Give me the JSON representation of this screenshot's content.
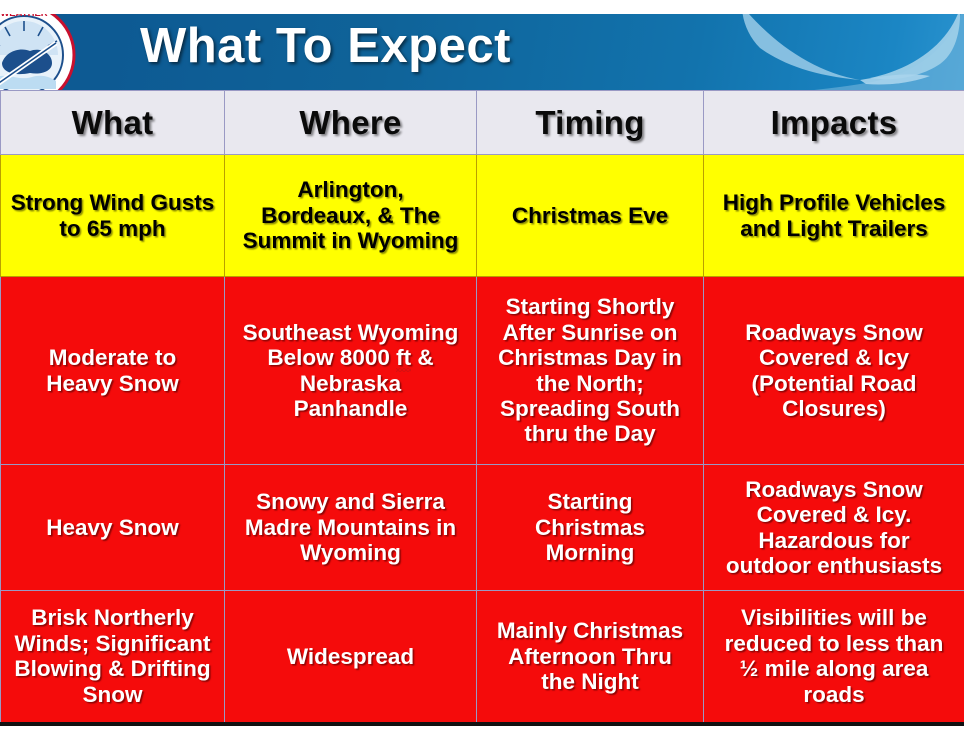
{
  "banner": {
    "title": "What To Expect",
    "logo_alt": "nws-logo",
    "gradient_start": "#0d5a93",
    "gradient_end": "#2a93cf",
    "swoosh_color": "#8cc3e3"
  },
  "colors": {
    "header_bg": "#e9e8ef",
    "yellow_bg": "#ffff00",
    "red_bg": "#f50b0b",
    "grid_line": "#9a99c4",
    "bottom_border": "#111111",
    "text_on_yellow": "#000000",
    "text_on_red": "#ffffff"
  },
  "table": {
    "headers": [
      "What",
      "Where",
      "Timing",
      "Impacts"
    ],
    "rows": [
      {
        "severity": "yellow",
        "what": "Strong Wind Gusts\nto 65 mph",
        "where": "Arlington,\nBordeaux, & The\nSummit in Wyoming",
        "timing": "Christmas Eve",
        "impacts": "High Profile Vehicles\nand Light Trailers"
      },
      {
        "severity": "red",
        "what": "Moderate to\nHeavy Snow",
        "where_part1": "Southeast Wyoming\nBelow 8000 ",
        "where_misspelled": "ft",
        "where_part2": " &\nNebraska\nPanhandle",
        "timing": "Starting Shortly\nAfter Sunrise on\nChristmas Day in\nthe North;\nSpreading South\nthru the Day",
        "impacts": "Roadways Snow\nCovered & Icy\n(Potential Road\nClosures)"
      },
      {
        "severity": "red",
        "what": "Heavy Snow",
        "where": "Snowy and Sierra\nMadre Mountains in\nWyoming",
        "timing": "Starting\nChristmas\nMorning",
        "impacts": "Roadways Snow\nCovered & Icy.\nHazardous for\noutdoor enthusiasts"
      },
      {
        "severity": "red",
        "what": "Brisk Northerly\nWinds; Significant\nBlowing & Drifting\nSnow",
        "where": "Widespread",
        "timing": "Mainly Christmas\nAfternoon Thru\nthe Night",
        "impacts": "Visibilities will be\nreduced to less than\n½ mile along area\nroads"
      }
    ]
  }
}
